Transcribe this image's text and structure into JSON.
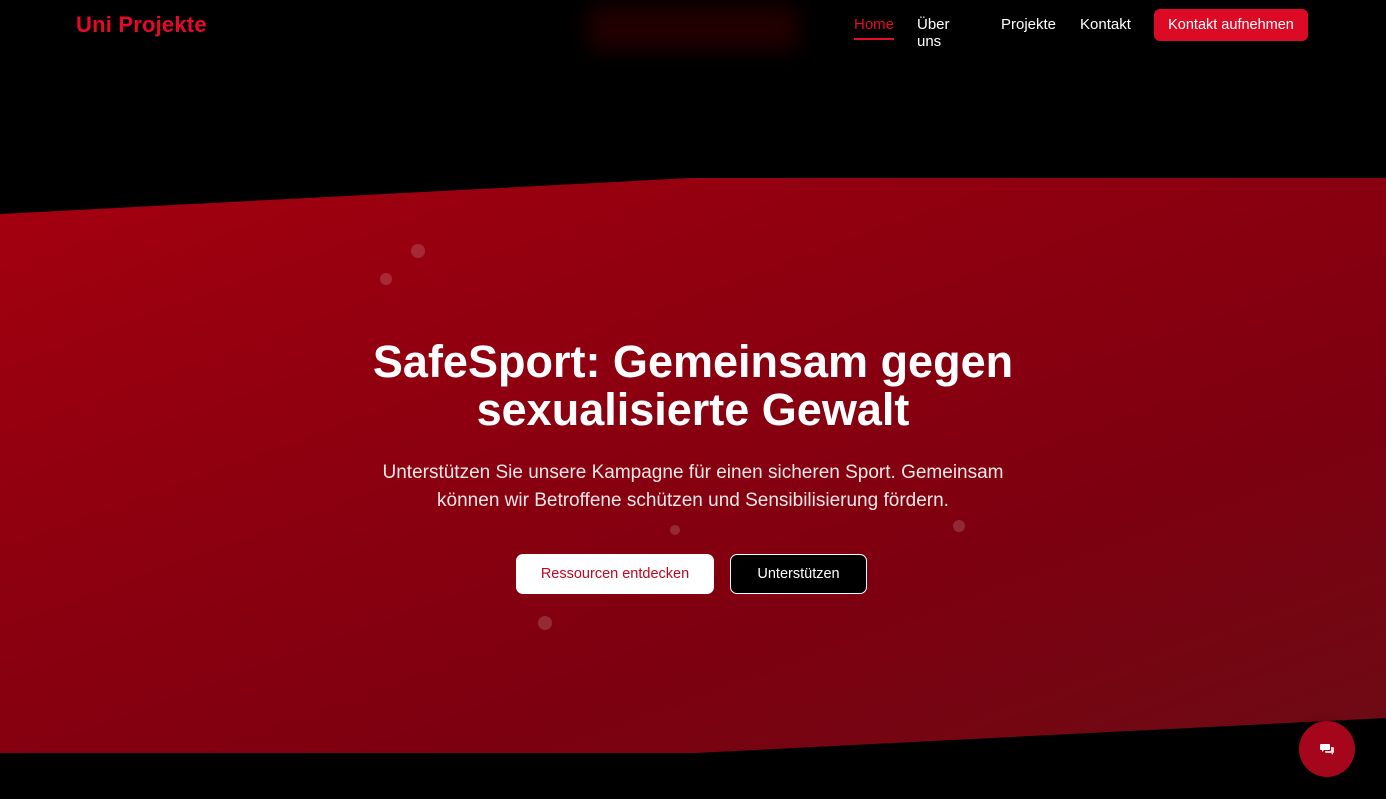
{
  "brand": {
    "logo": "Uni Projekte"
  },
  "nav": {
    "links": [
      {
        "label": "Home",
        "active": true
      },
      {
        "label": "Über uns",
        "active": false
      },
      {
        "label": "Projekte",
        "active": false
      },
      {
        "label": "Kontakt",
        "active": false
      }
    ],
    "cta": "Kontakt aufnehmen"
  },
  "hero": {
    "title_line1": "SafeSport: Gemeinsam gegen",
    "title_line2": "sexualisierte Gewalt",
    "subtitle_line1": "Unterstützen Sie unsere Kampagne für einen sicheren Sport. Gemeinsam",
    "subtitle_line2": "können wir Betroffene schützen und Sensibilisierung fördern.",
    "primary_button": "Ressourcen entdecken",
    "secondary_button": "Unterstützen"
  },
  "chat": {
    "icon": "chat-bubbles-icon"
  },
  "colors": {
    "accent": "#e50a2a",
    "hero_top": "#b0000f",
    "hero_bottom": "#6a0d15",
    "background": "#000000"
  }
}
